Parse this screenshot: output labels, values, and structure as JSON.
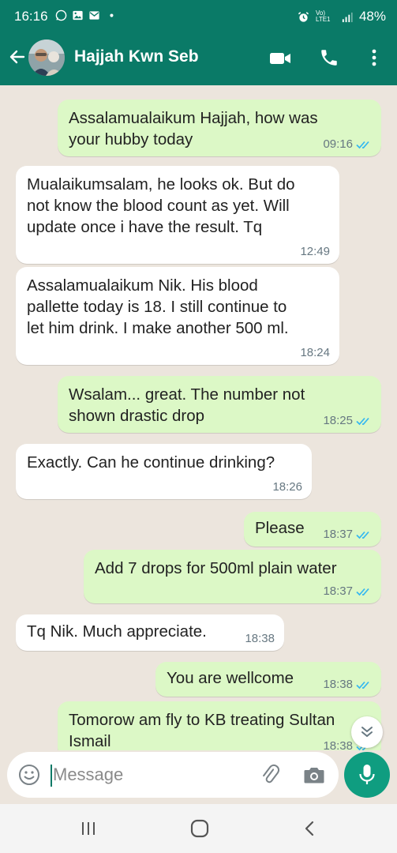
{
  "status_bar": {
    "time": "16:16",
    "network": "Vo) LTE1",
    "battery": "48%"
  },
  "header": {
    "contact_name": "Hajjah Kwn Seb"
  },
  "messages": [
    {
      "direction": "out",
      "lines": [
        "Assalamualaikum Hajjah, how was",
        "your hubby today"
      ],
      "time": "09:16",
      "read": true
    },
    {
      "direction": "in",
      "lines": [
        "Mualaikumsalam, he looks ok. But do",
        "not know the blood count as yet. Will",
        "update once i have the result. Tq"
      ],
      "time": "12:49"
    },
    {
      "direction": "in",
      "lines": [
        "Assalamualaikum Nik. His blood",
        "pallette today is 18. I still continue to",
        "let him drink. I make another 500 ml."
      ],
      "time": "18:24"
    },
    {
      "direction": "out",
      "lines": [
        "Wsalam... great. The number not",
        "shown drastic drop"
      ],
      "time": "18:25",
      "read": true
    },
    {
      "direction": "in",
      "lines": [
        "Exactly. Can he continue drinking?"
      ],
      "time": "18:26"
    },
    {
      "direction": "out",
      "lines": [
        "Please"
      ],
      "time": "18:37",
      "read": true
    },
    {
      "direction": "out",
      "lines": [
        "Add 7 drops for 500ml plain water"
      ],
      "time": "18:37",
      "read": true
    },
    {
      "direction": "in",
      "lines": [
        "Tq Nik. Much appreciate."
      ],
      "time": "18:38"
    },
    {
      "direction": "out",
      "lines": [
        "You are wellcome"
      ],
      "time": "18:38",
      "read": true
    },
    {
      "direction": "out",
      "lines": [
        "Tomorow am fly to KB treating Sultan",
        "Ismail"
      ],
      "time": "18:38",
      "read": true
    }
  ],
  "input": {
    "placeholder": "Message"
  },
  "colors": {
    "header": "#0a7a67",
    "outgoing_bubble": "#dcf8c6",
    "incoming_bubble": "#ffffff",
    "chat_background": "#ece5dd",
    "read_tick": "#34b7f1",
    "mic_button": "#0f9d80"
  },
  "icons": {
    "back": "arrow-left-icon",
    "video": "video-call-icon",
    "call": "phone-icon",
    "menu": "more-vertical-icon",
    "emoji": "emoji-icon",
    "attach": "paperclip-icon",
    "camera": "camera-icon",
    "mic": "microphone-icon",
    "scroll": "chevron-double-down-icon"
  }
}
